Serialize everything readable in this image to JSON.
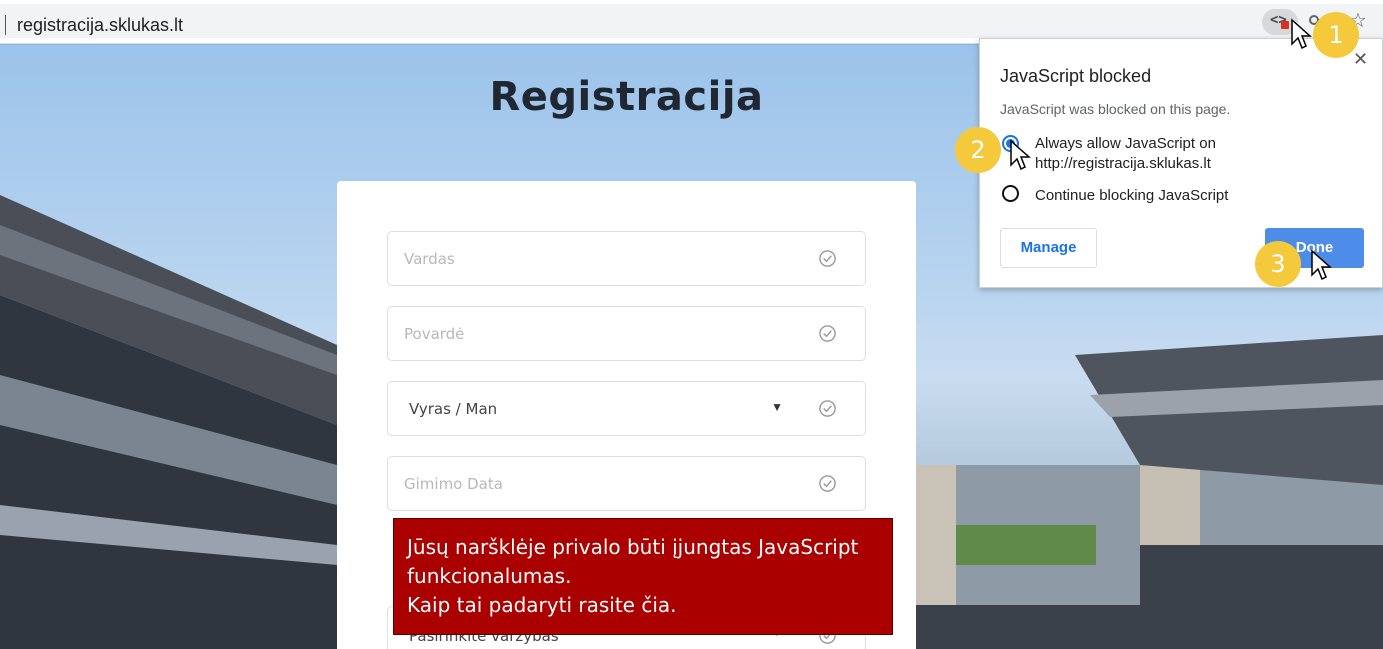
{
  "browser": {
    "url": "registracija.sklukas.lt"
  },
  "page": {
    "title": "Registracija",
    "fields": {
      "first_name_placeholder": "Vardas",
      "last_name_placeholder": "Povardė",
      "gender_value": "Vyras / Man",
      "birth_date_placeholder": "Gimimo Data",
      "competition_partial": "Pasirinkite varžybas"
    },
    "warning": {
      "line1": "Jūsų naršklėje privalo būti įjungtas JavaScript",
      "line2": "funkcionalumas.",
      "line3": "Kaip tai padaryti rasite čia."
    }
  },
  "popup": {
    "title": "JavaScript blocked",
    "description": "JavaScript was blocked on this page.",
    "option_allow": "Always allow JavaScript on http://registracija.sklukas.lt",
    "option_block": "Continue blocking JavaScript",
    "manage_label": "Manage",
    "done_label": "Done",
    "close_symbol": "✕"
  },
  "steps": {
    "one": "1",
    "two": "2",
    "three": "3"
  },
  "colors": {
    "warning_bg": "#ab0000",
    "accent_blue": "#1a73e8",
    "step_yellow": "#f5c93c"
  }
}
